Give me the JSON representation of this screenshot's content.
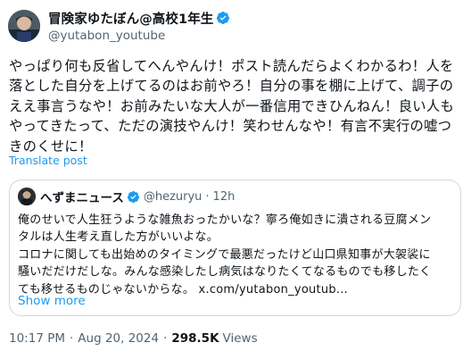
{
  "tweet": {
    "author_name": "冒険家ゆたぼん@高校1年生",
    "author_handle": "@yutabon_youtube",
    "text": "やっぱり何も反省してへんやんけ！ポスト読んだらよくわかるわ！人を落とした自分を上げてるのはお前やろ！自分の事を棚に上げて、調子のええ事言うなや！お前みたいな大人が一番信用できひんねん！良い人もやってきたって、ただの演技やんけ！笑わせんなや！有言不実行の嘘つきのくせに！",
    "translate_label": "Translate post"
  },
  "quote": {
    "author_name": "へずまニュース",
    "author_handle": "@hezuryu",
    "separator": "·",
    "time": "12h",
    "lines": [
      "俺のせいで人生狂うような雑魚おったかいな？寧ろ俺如きに潰される豆腐メン",
      "タルは人生考え直した方がいいよな。",
      "コロナに関しても出始めのタイミングで最悪だったけど山口県知事が大袈裟に",
      "騒いだだけだしな。みんな感染したし病気はなりたくてなるものでも移したく",
      "ても移せるものじゃないからな。"
    ],
    "link_text": "x.com/yutabon_youtub...",
    "show_more": "Show more"
  },
  "meta": {
    "time": "10:17 PM",
    "separator": "·",
    "date": "Aug 20, 2024",
    "views_count": "298.5K",
    "views_label": "Views"
  },
  "colors": {
    "accent": "#1d9bf0",
    "secondary_text": "#536471",
    "border": "#cfd9de"
  },
  "icons": {
    "verified": "verified-badge-icon"
  }
}
